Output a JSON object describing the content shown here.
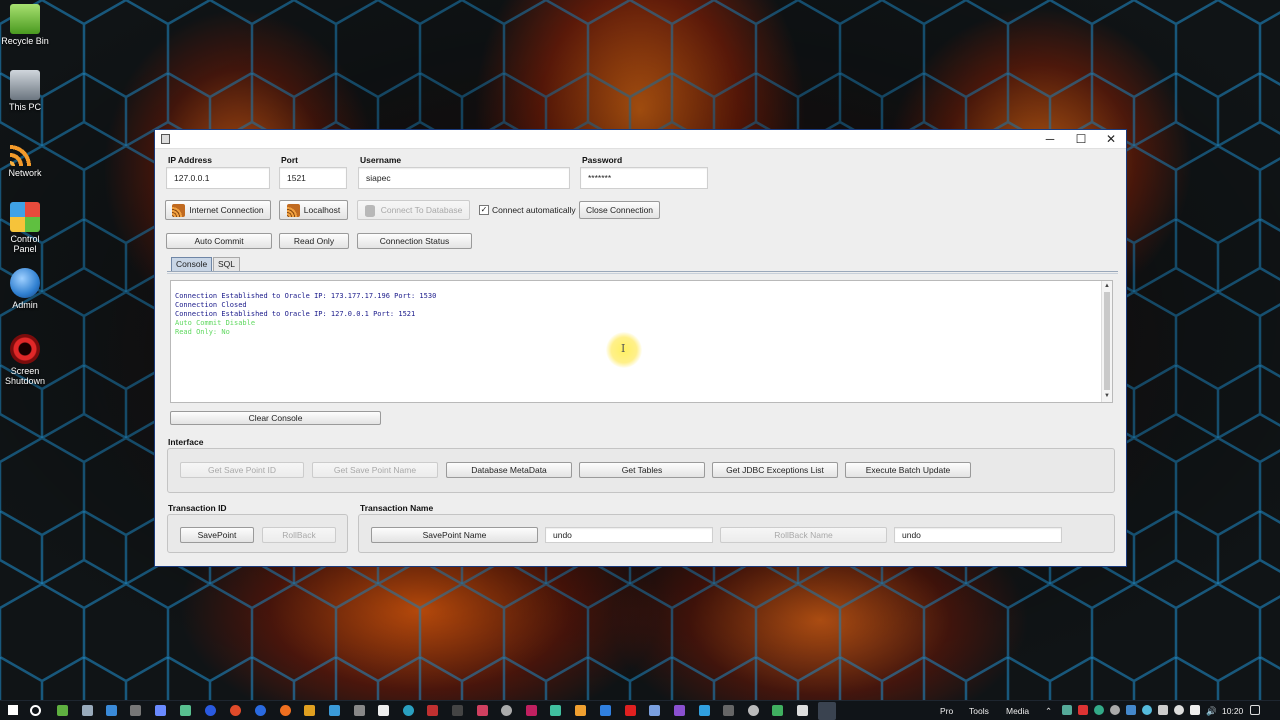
{
  "desktop": {
    "icons": [
      {
        "label": "Recycle Bin",
        "icon": "recycle-bin-icon",
        "color": "#7fd04a"
      },
      {
        "label": "This PC",
        "icon": "computer-icon",
        "color": "#9aa4b0"
      },
      {
        "label": "Network",
        "icon": "rss-icon",
        "color": "#f39a2a"
      },
      {
        "label": "Control Panel",
        "icon": "control-panel-icon",
        "color": "#3fa2e6"
      },
      {
        "label": "Admin",
        "icon": "admin-icon",
        "color": "#2f7fd0"
      },
      {
        "label": "Screen Shutdown",
        "icon": "power-icon",
        "color": "#d32020"
      }
    ]
  },
  "window": {
    "controls": {
      "minimize": "─",
      "maximize": "☐",
      "close": "✕"
    },
    "fields": {
      "ip": {
        "label": "IP Address",
        "value": "127.0.0.1"
      },
      "port": {
        "label": "Port",
        "value": "1521"
      },
      "username": {
        "label": "Username",
        "value": "siapec"
      },
      "password": {
        "label": "Password",
        "value": "*******"
      }
    },
    "buttons": {
      "internet_connection": "Internet Connection",
      "localhost": "Localhost",
      "connect_to_database": "Connect To Database",
      "connect_automatically": "Connect automatically",
      "close_connection": "Close Connection",
      "auto_commit": "Auto Commit",
      "read_only": "Read Only",
      "connection_status": "Connection Status",
      "clear_console": "Clear Console"
    },
    "checkbox_mark": "✓",
    "tabs": [
      "Console",
      "SQL"
    ],
    "console": {
      "lines": [
        {
          "text": "Connection Established to Oracle IP: 173.177.17.196 Port: 1530",
          "color": "#1a1a8a"
        },
        {
          "text": "Connection Closed",
          "color": "#1a1a8a"
        },
        {
          "text": "Connection Established to Oracle IP: 127.0.0.1 Port: 1521",
          "color": "#1a1a8a"
        },
        {
          "text": "Auto Commit Disable",
          "color": "#5fd85f"
        },
        {
          "text": "Read Only: No",
          "color": "#5fd85f"
        }
      ]
    },
    "interface": {
      "label": "Interface",
      "buttons": [
        {
          "label": "Get Save Point ID",
          "enabled": false
        },
        {
          "label": "Get Save Point Name",
          "enabled": false
        },
        {
          "label": "Database MetaData",
          "enabled": true
        },
        {
          "label": "Get Tables",
          "enabled": true
        },
        {
          "label": "Get JDBC Exceptions List",
          "enabled": true
        },
        {
          "label": "Execute Batch Update",
          "enabled": true
        }
      ]
    },
    "transaction_id": {
      "label": "Transaction ID",
      "savepoint": "SavePoint",
      "rollback": "RollBack"
    },
    "transaction_name": {
      "label": "Transaction Name",
      "savepoint_name": "SavePoint Name",
      "savepoint_value": "undo",
      "rollback_name": "RollBack Name",
      "rollback_value": "undo"
    }
  },
  "taskbar": {
    "labels": {
      "pro": "Pro",
      "tools": "Tools",
      "media": "Media"
    },
    "clock": "10:20"
  }
}
